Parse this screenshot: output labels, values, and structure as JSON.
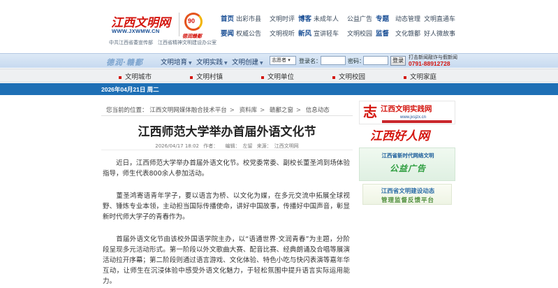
{
  "header": {
    "logo_text": "江西文明网",
    "logo_url": "WWW.JXWMW.CN",
    "badge_number": "90",
    "badge_text": "德润赣鄱",
    "org_line": "中共江西省委宣传部　江西省精神文明建设办公室"
  },
  "nav": {
    "row1": [
      {
        "head": "首页",
        "links": [
          "出彩市县",
          "文明时评"
        ]
      },
      {
        "head": "博客",
        "links": [
          "未成年人",
          "公益广告"
        ]
      },
      {
        "head": "专题",
        "links": [
          "动态管理",
          "文明直通车"
        ]
      }
    ],
    "row2": [
      {
        "head": "要闻",
        "links": [
          "权威公告",
          "文明视听"
        ]
      },
      {
        "head": "新风",
        "links": [
          "宣讲轻车",
          "文明校园"
        ]
      },
      {
        "head": "监督",
        "links": [
          "文化赣鄱",
          "好人微故事"
        ]
      }
    ]
  },
  "toolbar": {
    "banner": "德润·赣鄱",
    "menus": [
      "文明培育",
      "文明实践",
      "文明创建"
    ],
    "select_value": "志愿者",
    "login_label": "登录名：",
    "password_label": "密码：",
    "login_button": "登录",
    "hotline_label": "打击新闻敲诈与假新闻",
    "hotline_phone": "0791-88912728"
  },
  "subnav": [
    "文明城市",
    "文明村镇",
    "文明单位",
    "文明校园",
    "文明家庭"
  ],
  "date": "2026年04月21日 周二",
  "breadcrumb": {
    "prefix": "您当前的位置：",
    "items": [
      "江西文明网媒体融合技术平台",
      "资料库",
      "赣鄱之窗",
      "信息动态"
    ]
  },
  "article": {
    "title": "江西师范大学举办首届外语文化节",
    "date": "2026/04/17 18:02",
    "author_label": "作者：",
    "author": "",
    "editor_label": "编辑：",
    "editor": "左留",
    "source_label": "来源：",
    "source": "江西文明网",
    "paragraphs": [
      "近日，江西师范大学举办首届外语文化节。校党委常委、副校长董圣鸿到场体验指导，师生代表800余人参加活动。",
      "董圣鸿寄语青年学子，要以语言为桥、以文化为媒，在多元交流中拓展全球视野、锤炼专业本领，主动担当国际传播使命，讲好中国故事，传播好中国声音，彰显新时代师大学子的青春作为。",
      "首届外语文化节由该校外国语学院主办，以“语通世界·文润青春”为主题，分阶段呈现多元活动形式。第一阶段以外文歌曲大赛、配音比赛、经典朗诵及合唱等展演活动拉开序幕；第二阶段则通过语言游戏、文化体验、特色小吃与快闪表演等嘉年华互动，让师生在沉浸体验中感受外语文化魅力，于轻松氛围中提升语言实际运用能力。"
    ]
  },
  "sidebar": {
    "ad1_title": "江西文明实践网",
    "ad1_url": "www.jxsjzx.cn",
    "ad2_text": "江西好人网",
    "ad3_line1": "江西省新时代网络文明",
    "ad3_line2": "公益广告",
    "ad4_line1": "江西省文明建设动态",
    "ad4_line2": "管理监督反馈平台"
  }
}
